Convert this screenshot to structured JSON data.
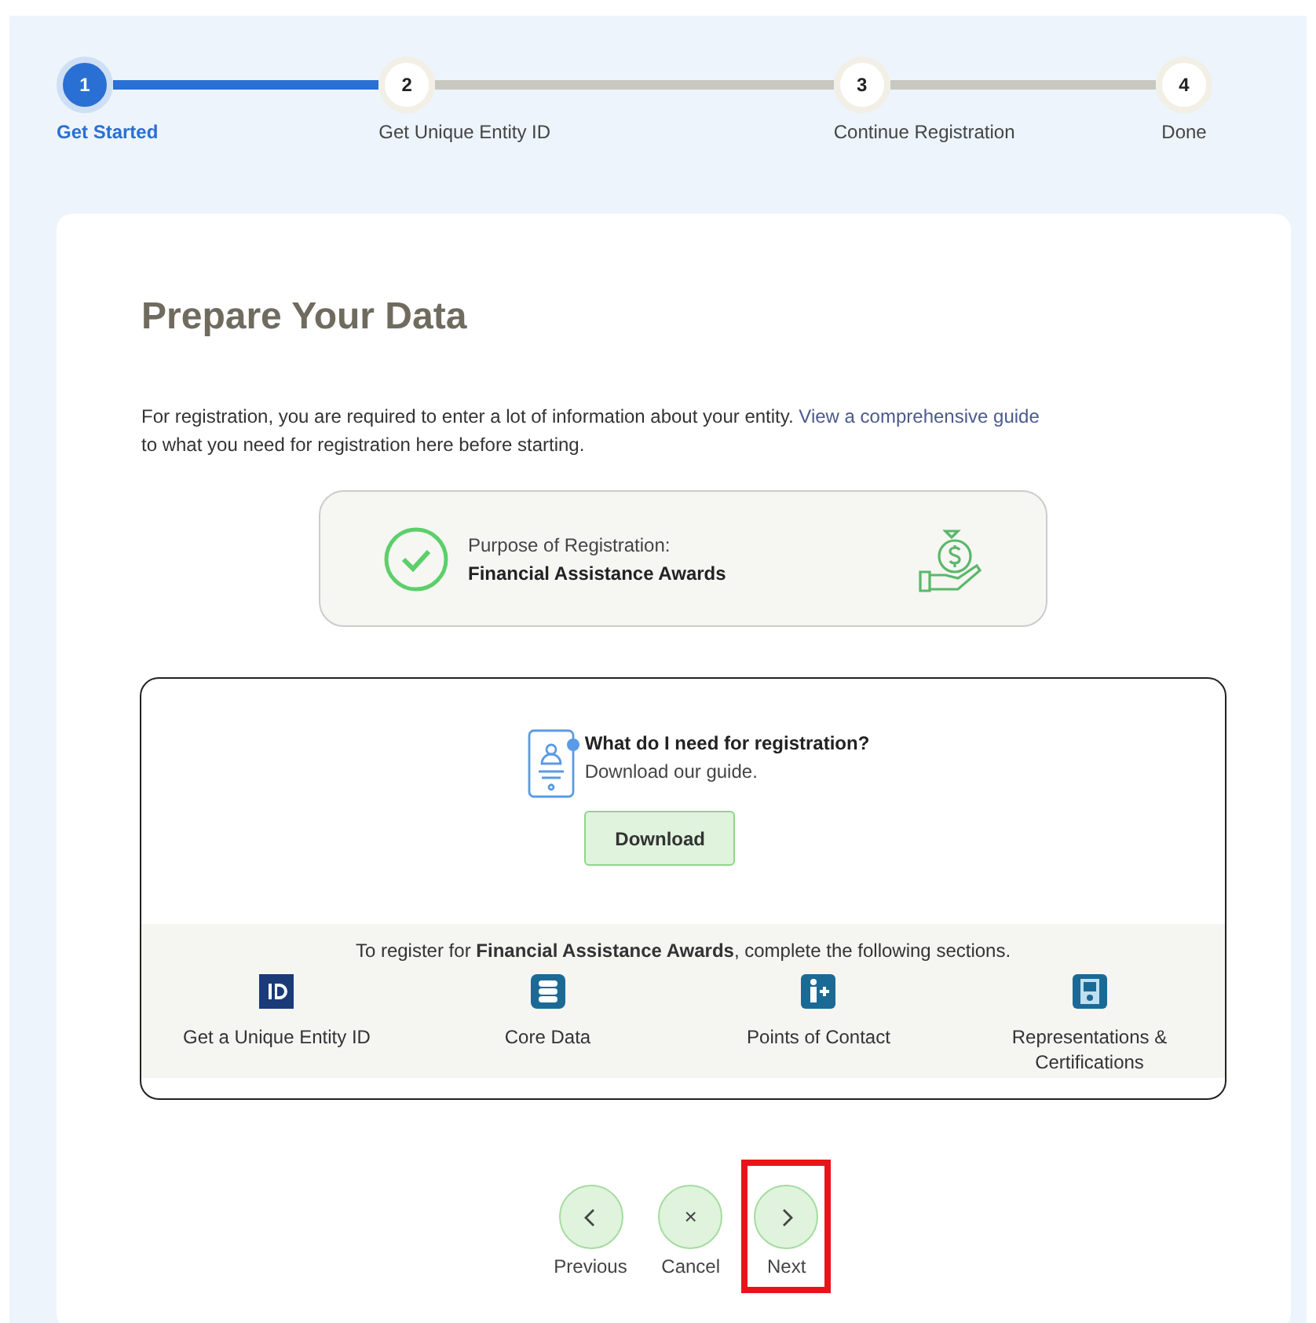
{
  "steps": [
    {
      "number": "1",
      "label": "Get Started",
      "selected": true,
      "completed_line": true
    },
    {
      "number": "2",
      "label": "Get Unique Entity ID",
      "selected": false,
      "completed_line": false
    },
    {
      "number": "3",
      "label": "Continue Registration",
      "selected": false,
      "completed_line": false
    },
    {
      "number": "4",
      "label": "Done",
      "selected": false
    }
  ],
  "title": "Prepare Your Data",
  "intro": {
    "before": "For registration, you are required to enter a lot of information about your entity. ",
    "link": "View a comprehensive guide",
    "after": " to what you need for registration here before starting."
  },
  "purpose": {
    "label": "Purpose of Registration:",
    "value": "Financial Assistance Awards"
  },
  "guide": {
    "heading": "What do I need for registration?",
    "subtext": "Download our guide.",
    "button": "Download"
  },
  "sections": {
    "intro": "To register for **Financial Assistance Awards**, complete the following sections.",
    "items": [
      {
        "kind": "id",
        "label": "Get a Unique Entity ID"
      },
      {
        "kind": "database",
        "label": "Core Data"
      },
      {
        "kind": "contact",
        "label": "Points of Contact"
      },
      {
        "kind": "certificate",
        "label": "Representations & Certifications"
      }
    ]
  },
  "nav": [
    {
      "kind": "previous",
      "label": "Previous",
      "highlighted": false
    },
    {
      "kind": "cancel",
      "symbol": "×",
      "label": "Cancel",
      "highlighted": false
    },
    {
      "kind": "next",
      "label": "Next",
      "highlighted": true
    }
  ]
}
